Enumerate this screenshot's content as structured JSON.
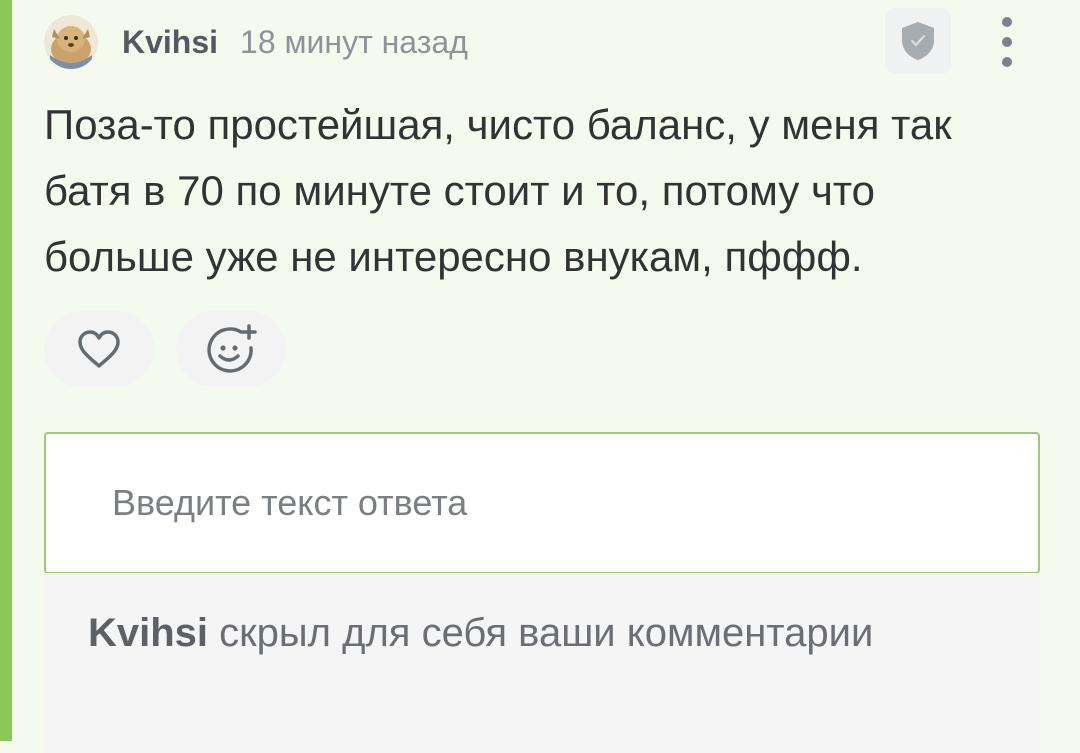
{
  "comment": {
    "author": "Kvihsi",
    "time": "18 минут назад",
    "text": "Поза-то простейшая, чисто баланс, у меня так батя в 70 по минуте стоит и то, потому что больше уже не интересно внукам, пффф."
  },
  "icons": {
    "avatar": "avatar-image",
    "moderation": "shield-check-icon",
    "menu": "more-vertical-icon",
    "like": "heart-icon",
    "react": "smiley-plus-icon"
  },
  "reply": {
    "placeholder": "Введите текст ответа",
    "value": ""
  },
  "notice": {
    "name": "Kvihsi",
    "text": " скрыл для себя ваши комментарии"
  },
  "colors": {
    "accent_bar": "#8ac858",
    "background": "#f4fbee",
    "input_border": "#9bcc75"
  }
}
